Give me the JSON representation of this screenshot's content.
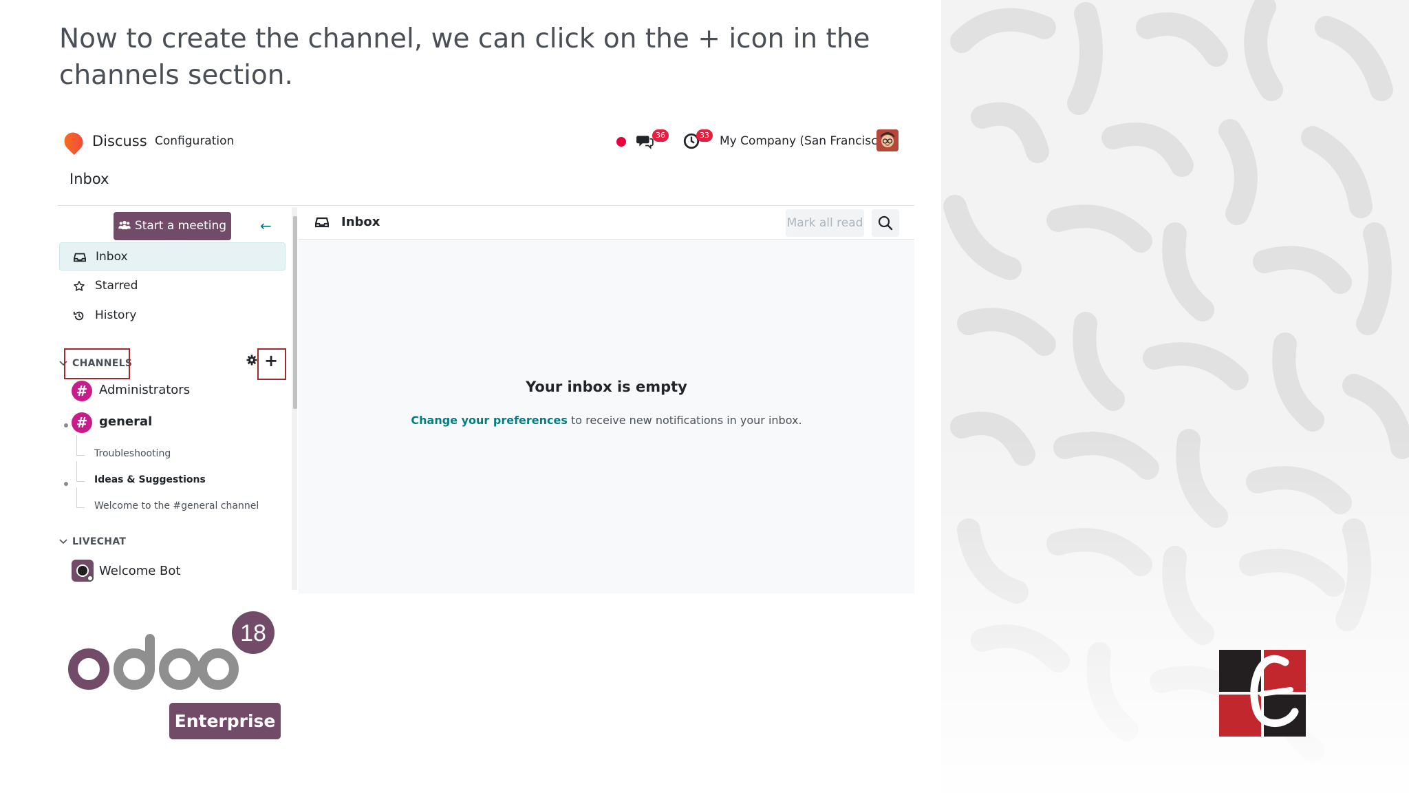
{
  "caption": "Now to create the channel, we can click on the + icon in the channels section.",
  "topbar": {
    "app_name": "Discuss",
    "menu_configuration": "Configuration",
    "messages_badge": "36",
    "activities_badge": "33",
    "company": "My Company (San Francisco)"
  },
  "breadcrumb": "Inbox",
  "sidebar": {
    "start_meeting_label": "Start a meeting",
    "nav_items": [
      {
        "label": "Inbox",
        "icon": "inbox-icon"
      },
      {
        "label": "Starred",
        "icon": "star-icon"
      },
      {
        "label": "History",
        "icon": "history-icon"
      }
    ],
    "channels_header": "CHANNELS",
    "channels": [
      {
        "label": "Administrators"
      },
      {
        "label": "general"
      }
    ],
    "threads": [
      {
        "label": "Troubleshooting"
      },
      {
        "label": "Ideas & Suggestions"
      },
      {
        "label": "Welcome to the #general channel"
      }
    ],
    "livechat_header": "LIVECHAT",
    "livechat": [
      {
        "label": "Welcome Bot"
      }
    ]
  },
  "main": {
    "title": "Inbox",
    "mark_all_read": "Mark all read",
    "empty_title": "Your inbox is empty",
    "pref_link": "Change your preferences",
    "empty_message": " to receive new notifications in your inbox."
  },
  "branding": {
    "odoo_version": "18",
    "odoo_edition": "Enterprise"
  },
  "colors": {
    "brand": "#714b67",
    "accent": "#017e84",
    "badge": "#e41e3f",
    "channel_avatar": "#c81c8c",
    "highlight_box": "#9e2a2b"
  }
}
